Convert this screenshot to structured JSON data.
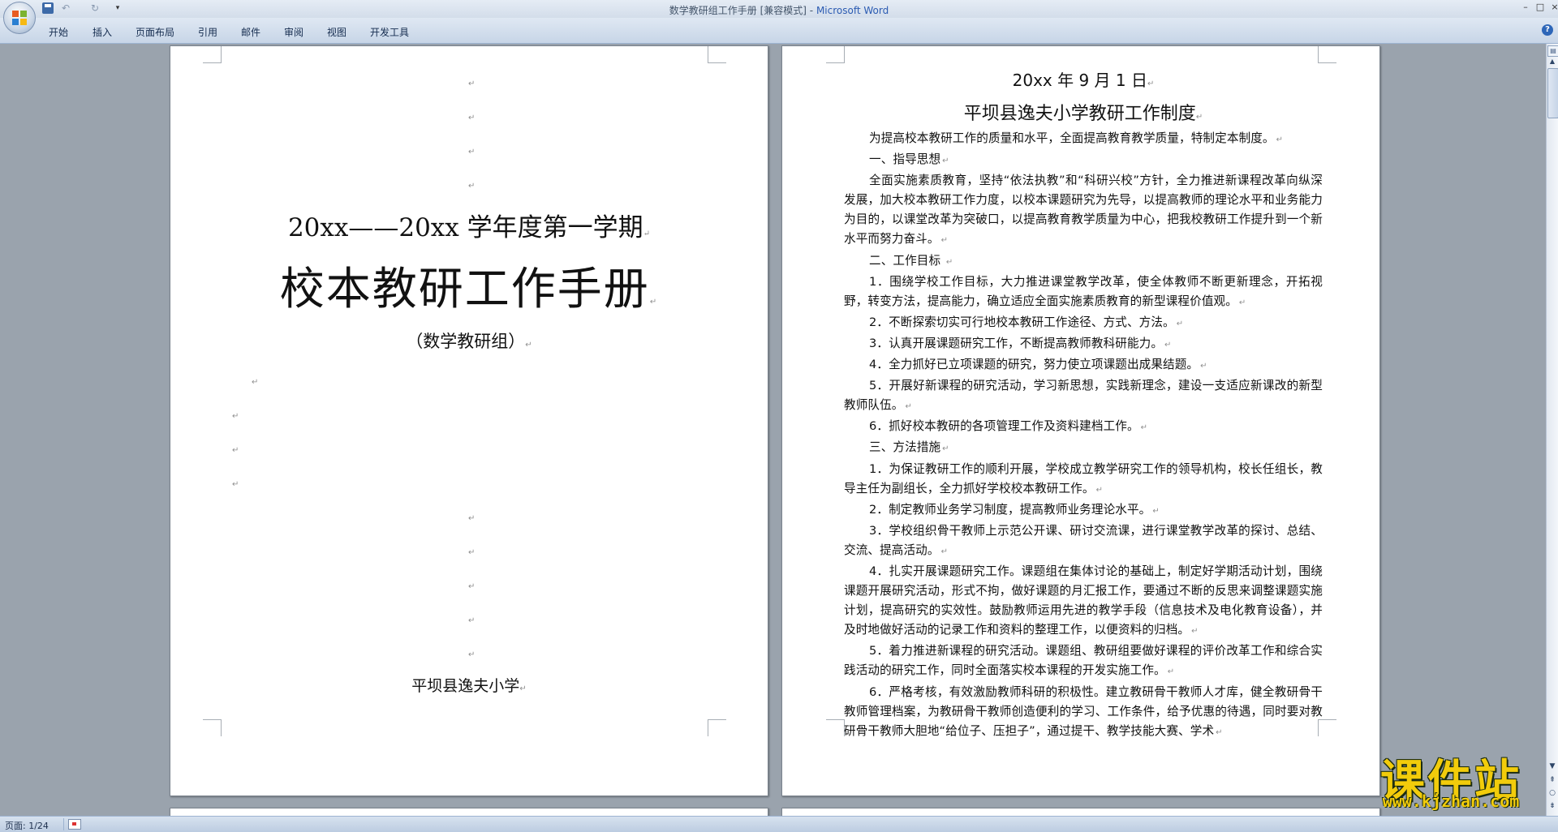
{
  "window": {
    "title": "数学教研组工作手册 [兼容模式]",
    "separator": " - ",
    "app_name": "Microsoft Word",
    "min": "–",
    "max": "□",
    "close": "×"
  },
  "quick_access": {
    "undo": "↶",
    "redo": "↻",
    "customize": "▾"
  },
  "tabs": [
    "开始",
    "插入",
    "页面布局",
    "引用",
    "邮件",
    "审阅",
    "视图",
    "开发工具"
  ],
  "help": "?",
  "mark": "↵",
  "cover": {
    "year": "20xx——20xx 学年度第一学期",
    "title": "校本教研工作手册",
    "group": "（数学教研组）",
    "school": "平坝县逸夫小学"
  },
  "page2": {
    "date": "20xx 年 9 月 1 日",
    "heading": "平坝县逸夫小学教研工作制度",
    "paragraphs": [
      "为提高校本教研工作的质量和水平，全面提高教育教学质量，特制定本制度。",
      "一、指导思想",
      "全面实施素质教育，坚持“依法执教”和“科研兴校”方针，全力推进新课程改革向纵深发展，加大校本教研工作力度，以校本课题研究为先导，以提高教师的理论水平和业务能力为目的，以课堂改革为突破口，以提高教育教学质量为中心，把我校教研工作提升到一个新水平而努力奋斗。",
      "二、工作目标 ",
      "1．围绕学校工作目标，大力推进课堂教学改革，使全体教师不断更新理念，开拓视野，转变方法，提高能力，确立适应全面实施素质教育的新型课程价值观。",
      "2．不断探索切实可行地校本教研工作途径、方式、方法。",
      "3．认真开展课题研究工作，不断提高教师教科研能力。",
      "4．全力抓好已立项课题的研究，努力使立项课题出成果结题。",
      "5．开展好新课程的研究活动，学习新思想，实践新理念，建设一支适应新课改的新型教师队伍。",
      "6．抓好校本教研的各项管理工作及资料建档工作。",
      "三、方法措施",
      "1．为保证教研工作的顺利开展，学校成立教学研究工作的领导机构，校长任组长，教导主任为副组长，全力抓好学校校本教研工作。",
      "2．制定教师业务学习制度，提高教师业务理论水平。",
      "3．学校组织骨干教师上示范公开课、研讨交流课，进行课堂教学改革的探讨、总结、交流、提高活动。",
      "4．扎实开展课题研究工作。课题组在集体讨论的基础上，制定好学期活动计划，围绕课题开展研究活动，形式不拘，做好课题的月汇报工作，要通过不断的反思来调整课题实施计划，提高研究的实效性。鼓励教师运用先进的教学手段（信息技术及电化教育设备），并及时地做好活动的记录工作和资料的整理工作，以便资料的归档。",
      "5．着力推进新课程的研究活动。课题组、教研组要做好课程的评价改革工作和综合实践活动的研究工作，同时全面落实校本课程的开发实施工作。",
      "6．严格考核，有效激励教师科研的积极性。建立教研骨干教师人才库，健全教研骨干教师管理档案，为教研骨干教师创造便利的学习、工作条件，给予优惠的待遇，同时要对教研骨干教师大胆地“给位子、压担子”，通过提干、教学技能大赛、学术"
    ]
  },
  "scroll": {
    "up": "▲",
    "down": "▼",
    "prev": "⇞",
    "browse": "○",
    "next": "⇟"
  },
  "status": {
    "page": "页面: 1/24"
  },
  "watermark": {
    "title": "课件站",
    "url": "www.kjzhan.com"
  }
}
